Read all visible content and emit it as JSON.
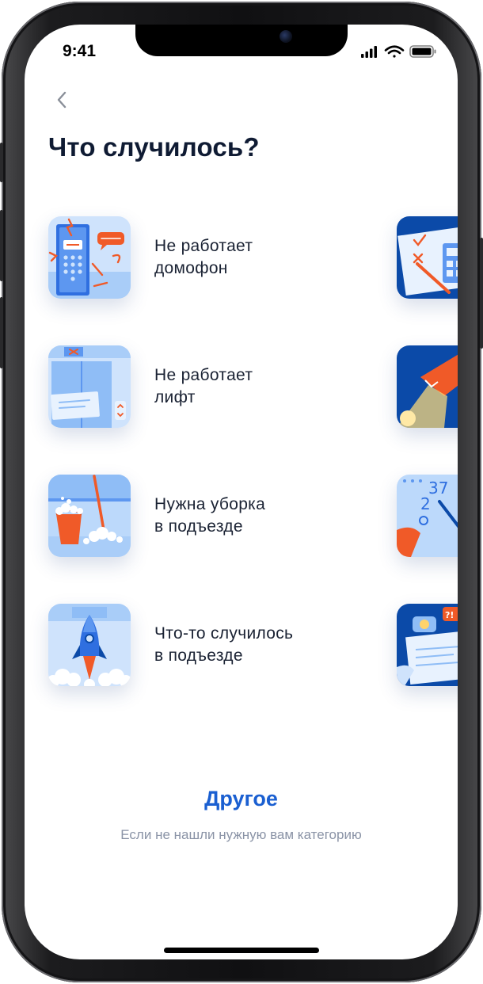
{
  "status_bar": {
    "time": "9:41"
  },
  "title": "Что случилось?",
  "categories": [
    {
      "label": "Не работает\nдомофон",
      "icon": "intercom-icon"
    },
    {
      "label": "Не работает\nлифт",
      "icon": "elevator-icon"
    },
    {
      "label": "Нужна уборка\nв подъезде",
      "icon": "cleaning-icon"
    },
    {
      "label": "Что-то случилось\nв подъезде",
      "icon": "rocket-icon"
    }
  ],
  "peek_column_icons": [
    "documents-icon",
    "lamp-icon",
    "meter-icon",
    "complaint-icon"
  ],
  "other": {
    "label": "Другое",
    "subtitle": "Если не нашли нужную вам категорию"
  },
  "colors": {
    "title": "#0f1b33",
    "accent": "#1a5fd1",
    "subtitle": "#8a93a6",
    "thumb_light": "#bcd9fb",
    "thumb_blue": "#2f6fe0",
    "thumb_dark": "#0b4aa8",
    "thumb_orange": "#f05a28"
  }
}
